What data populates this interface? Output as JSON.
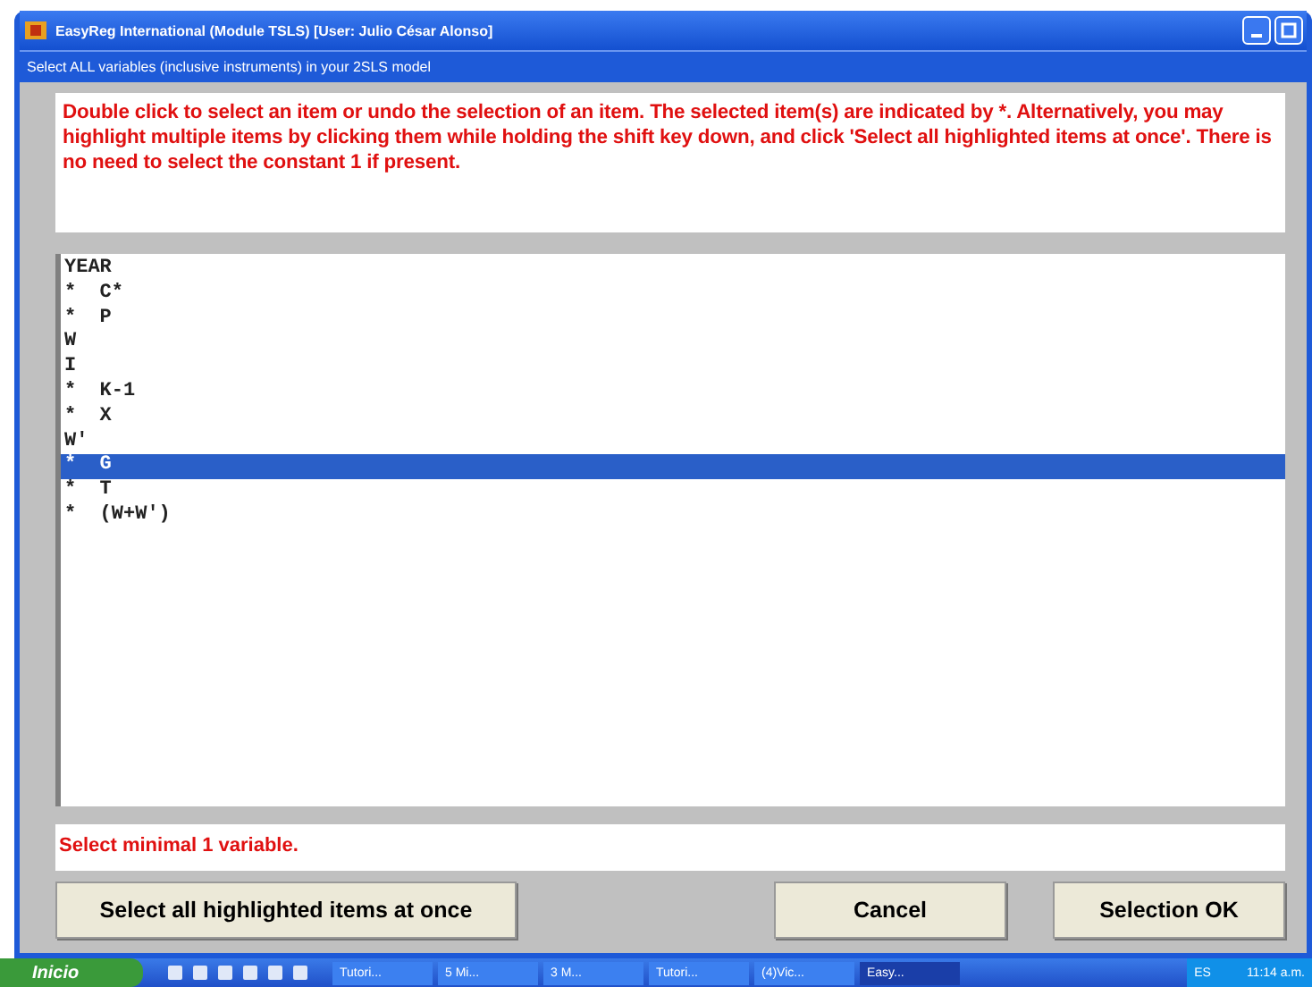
{
  "window": {
    "title": "EasyReg International (Module TSLS) [User: Julio César Alonso]"
  },
  "subtitle": "Select ALL variables (inclusive instruments) in your 2SLS model",
  "instructions": "Double click to select an item or undo the selection of an item. The selected item(s) are indicated by *. Alternatively, you may highlight multiple items by clicking them while holding the shift key down, and click 'Select all highlighted items at once'. There is no need to select the constant 1 if present.",
  "items": [
    {
      "label": "YEAR",
      "selected": false
    },
    {
      "label": "*  C*",
      "selected": false
    },
    {
      "label": "*  P",
      "selected": false
    },
    {
      "label": "W",
      "selected": false
    },
    {
      "label": "I",
      "selected": false
    },
    {
      "label": "*  K-1",
      "selected": false
    },
    {
      "label": "*  X",
      "selected": false
    },
    {
      "label": "W'",
      "selected": false
    },
    {
      "label": "*  G",
      "selected": true
    },
    {
      "label": "*  T",
      "selected": false
    },
    {
      "label": "*  (W+W')",
      "selected": false
    }
  ],
  "status": "Select minimal 1 variable.",
  "buttons": {
    "left": "Select all highlighted items at once",
    "cancel": "Cancel",
    "ok": "Selection OK"
  },
  "taskbar": {
    "start": "Inicio",
    "tasks": [
      {
        "label": "Tutori...",
        "selected": false
      },
      {
        "label": "5 Mi...",
        "selected": false
      },
      {
        "label": "3 M...",
        "selected": false
      },
      {
        "label": "Tutori...",
        "selected": false
      },
      {
        "label": "(4)Vic...",
        "selected": false
      },
      {
        "label": "Easy...",
        "selected": true
      }
    ],
    "lang": "ES",
    "clock": "11:14 a.m."
  }
}
